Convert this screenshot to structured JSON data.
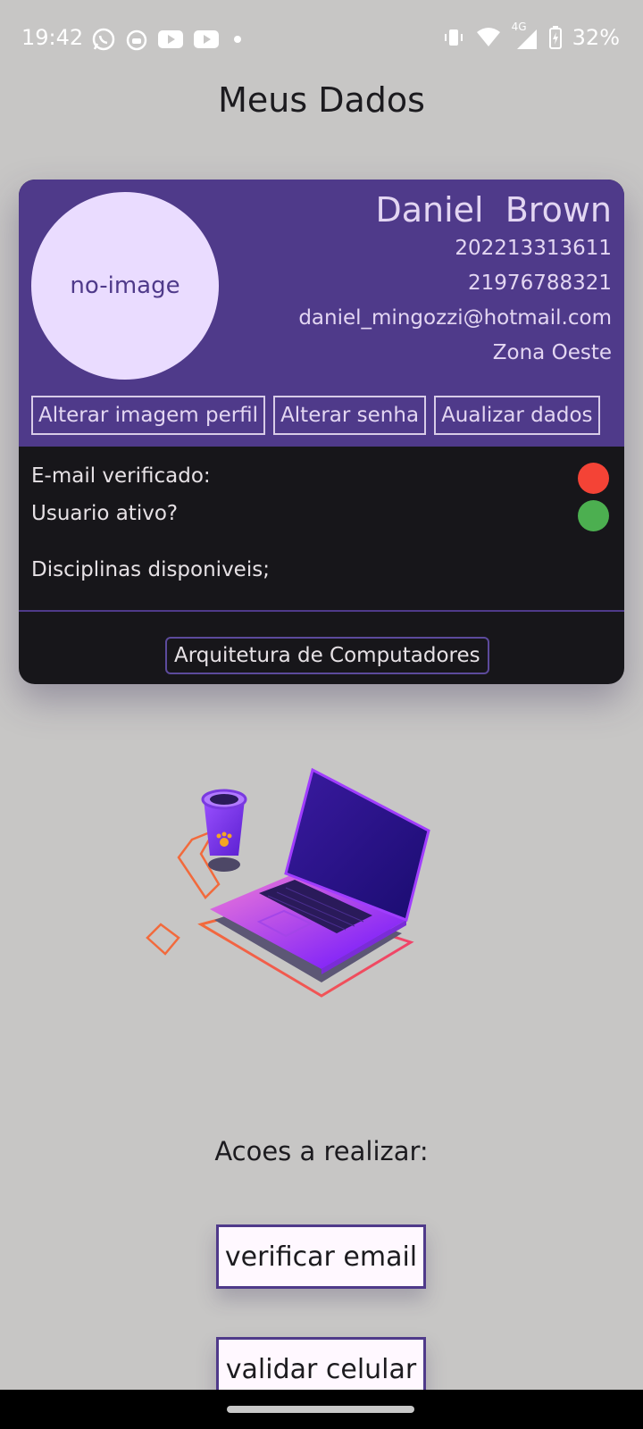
{
  "status_bar": {
    "time": "19:42",
    "network": "4G",
    "battery": "32%",
    "left_icons": [
      "whatsapp-icon",
      "cat-icon",
      "youtube-icon",
      "youtube-icon",
      "dot-icon"
    ],
    "right_icons": [
      "vibrate-icon",
      "wifi-icon",
      "signal-icon",
      "battery-charging-icon"
    ]
  },
  "page": {
    "title": "Meus Dados"
  },
  "profile": {
    "avatar_text": "no-image",
    "name": "Daniel  Brown",
    "id_number": "202213313611",
    "phone": "21976788321",
    "email": "daniel_mingozzi@hotmail.com",
    "region": "Zona Oeste",
    "buttons": {
      "change_image": "Alterar imagem perfil",
      "change_password": "Alterar senha",
      "update_data": "Aualizar dados"
    }
  },
  "status": {
    "email_verified_label": "E-mail verificado:",
    "email_verified_color": "#f44336",
    "user_active_label": "Usuario ativo?",
    "user_active_color": "#4caf50",
    "disciplines_label": "Disciplinas disponiveis;",
    "disciplines": [
      "Arquitetura de Computadores"
    ]
  },
  "actions": {
    "title": "Acoes a realizar:",
    "verify_email": "verificar email",
    "validate_phone": "validar celular"
  },
  "colors": {
    "accent": "#4f3a8a",
    "background": "#c7c6c5",
    "card_dark": "#17161a"
  }
}
